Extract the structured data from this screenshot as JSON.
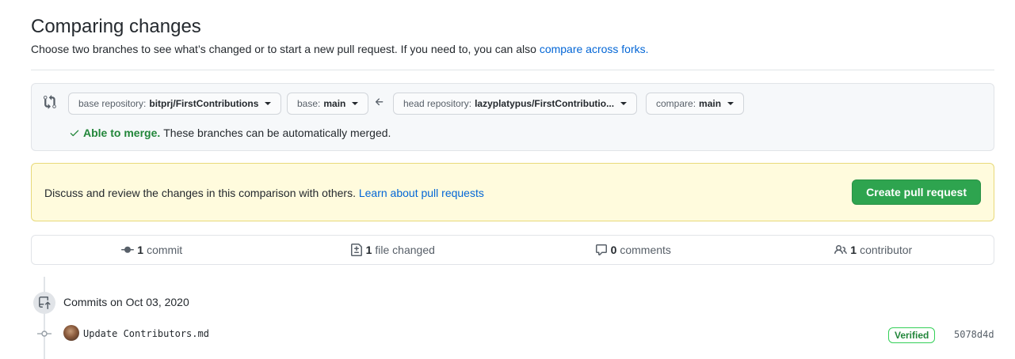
{
  "page": {
    "title": "Comparing changes",
    "subtitle": "Choose two branches to see what’s changed or to start a new pull request. If you need to, you can also ",
    "subtitle_link": "compare across forks."
  },
  "range": {
    "base_repo_label": "base repository:",
    "base_repo_value": "bitprj/FirstContributions",
    "base_label": "base:",
    "base_value": "main",
    "head_repo_label": "head repository:",
    "head_repo_value": "lazyplatypus/FirstContributio...",
    "compare_label": "compare:",
    "compare_value": "main",
    "merge_ok": "Able to merge.",
    "merge_text": "These branches can be automatically merged."
  },
  "flash": {
    "message": "Discuss and review the changes in this comparison with others. ",
    "link": "Learn about pull requests",
    "button": "Create pull request"
  },
  "summary": {
    "commits_count": "1",
    "commits_label": "commit",
    "files_count": "1",
    "files_label": "file changed",
    "comments_count": "0",
    "comments_label": "comments",
    "contributors_count": "1",
    "contributors_label": "contributor"
  },
  "commits": {
    "date_heading": "Commits on Oct 03, 2020",
    "items": [
      {
        "message": "Update Contributors.md",
        "badge": "Verified",
        "sha": "5078d4d"
      }
    ]
  },
  "colors": {
    "accent": "#0366d6",
    "success": "#2ea44f",
    "flash_bg": "#fffbdd"
  },
  "icons": [
    "git-compare-icon",
    "arrow-left-icon",
    "check-icon",
    "git-commit-icon",
    "file-diff-icon",
    "comment-icon",
    "people-icon",
    "repo-push-icon"
  ]
}
